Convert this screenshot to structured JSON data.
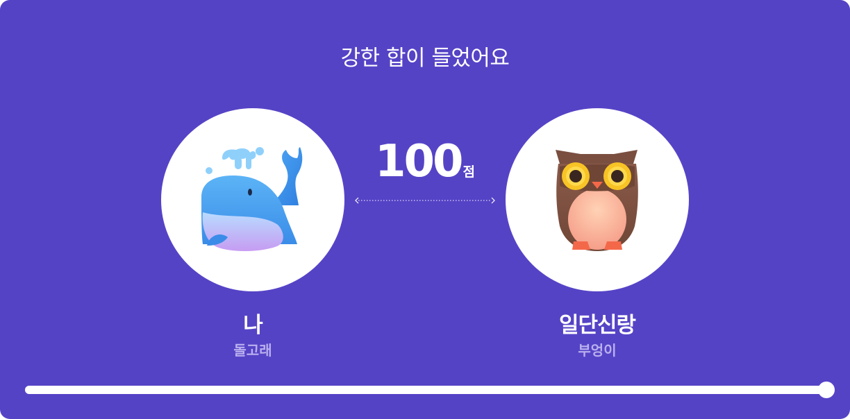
{
  "result": {
    "title": "강한 합이 들었어요",
    "score": "100",
    "score_unit": "점",
    "score_percent": 100
  },
  "me": {
    "name": "나",
    "type": "돌고래",
    "icon": "whale-icon"
  },
  "partner": {
    "name": "일단신랑",
    "type": "부엉이",
    "icon": "owl-icon"
  },
  "colors": {
    "background": "#5543c6",
    "text": "#ffffff",
    "subtext": "#b9b0ee"
  }
}
